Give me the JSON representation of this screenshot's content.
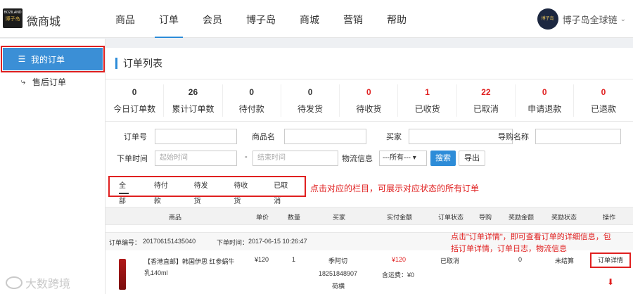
{
  "app": {
    "brand": "微商城",
    "logo_text": "博子岛",
    "logo_en": "BOZILAND"
  },
  "nav": {
    "items": [
      "商品",
      "订单",
      "会员",
      "博子岛",
      "商城",
      "营销",
      "帮助"
    ],
    "active_index": 1
  },
  "user": {
    "name": "博子岛全球链",
    "avatar_text": "博子岛"
  },
  "sidebar": {
    "items": [
      {
        "label": "我的订单",
        "icon": "list-icon"
      },
      {
        "label": "售后订单",
        "icon": "bolt-icon"
      }
    ]
  },
  "panel": {
    "title": "订单列表"
  },
  "stats": [
    {
      "value": "0",
      "label": "今日订单数"
    },
    {
      "value": "26",
      "label": "累计订单数"
    },
    {
      "value": "0",
      "label": "待付款"
    },
    {
      "value": "0",
      "label": "待发货"
    },
    {
      "value": "0",
      "label": "待收货"
    },
    {
      "value": "1",
      "label": "已收货"
    },
    {
      "value": "22",
      "label": "已取消"
    },
    {
      "value": "0",
      "label": "申请退款"
    },
    {
      "value": "0",
      "label": "已退款"
    }
  ],
  "filters": {
    "order_no_label": "订单号",
    "product_name_label": "商品名",
    "buyer_label": "买家",
    "guide_name_label": "导购名称",
    "order_time_label": "下单时间",
    "start_placeholder": "起始时间",
    "range_sep": "-",
    "end_placeholder": "结束时间",
    "logistics_label": "物流信息",
    "logistics_value": "---所有---",
    "search_button": "搜索",
    "export_button": "导出"
  },
  "tabs": [
    "全部",
    "待付款",
    "待发货",
    "待收货",
    "已取消"
  ],
  "annotations": {
    "tabs_note": "点击对应的栏目，可展示对应状态的所有订单",
    "detail_note_line1": "点击\"订单详情\"，即可查看订单的详细信息，包",
    "detail_note_line2": "括订单详情，订单日志，物流信息"
  },
  "table": {
    "headers": [
      "商品",
      "单价",
      "数量",
      "买家",
      "实付金额",
      "订单状态",
      "导购",
      "奖励金额",
      "奖励状态",
      "操作"
    ],
    "order": {
      "order_no_label": "订单编号：",
      "order_no": "201706151435040",
      "order_time_label": "下单时间：",
      "order_time": "2017-06-15 10:26:47",
      "product_line1": "【香港直邮】韩国伊思 红参蜗牛",
      "product_line2": "乳140ml",
      "price": "¥120",
      "qty": "1",
      "buyer_name": "季阿切",
      "buyer_phone": "18251848907",
      "buyer_extra": "荷横",
      "paid": "¥120",
      "shipping": "含运费：¥0",
      "status": "已取消",
      "reward_amount": "0",
      "reward_status": "未结算",
      "action": "订单详情"
    }
  },
  "watermark": {
    "text": "大数跨境"
  }
}
